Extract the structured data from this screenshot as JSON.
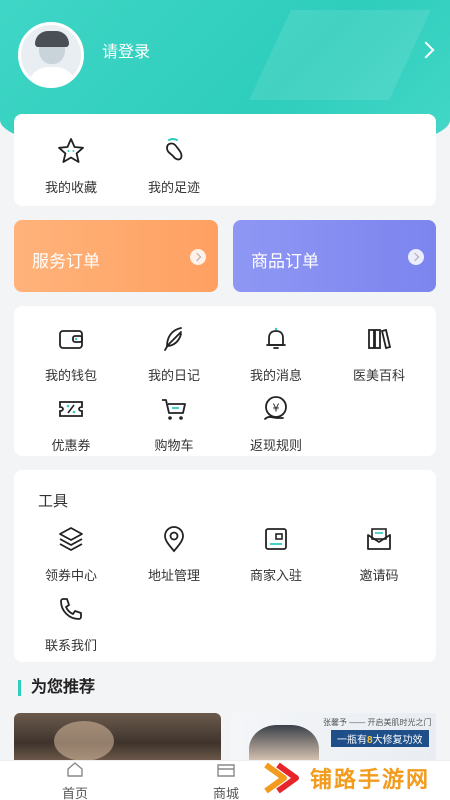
{
  "header": {
    "login_text": "请登录"
  },
  "quick": [
    {
      "label": "我的收藏",
      "icon": "star-icon"
    },
    {
      "label": "我的足迹",
      "icon": "footprint-icon"
    }
  ],
  "orders": {
    "service": "服务订单",
    "product": "商品订单"
  },
  "functions": [
    {
      "label": "我的钱包",
      "icon": "wallet-icon"
    },
    {
      "label": "我的日记",
      "icon": "feather-icon"
    },
    {
      "label": "我的消息",
      "icon": "bell-icon"
    },
    {
      "label": "医美百科",
      "icon": "books-icon"
    },
    {
      "label": "优惠券",
      "icon": "coupon-icon"
    },
    {
      "label": "购物车",
      "icon": "cart-icon"
    },
    {
      "label": "返现规则",
      "icon": "cashback-icon"
    }
  ],
  "tools": {
    "title": "工具",
    "items": [
      {
        "label": "领券中心",
        "icon": "layers-icon"
      },
      {
        "label": "地址管理",
        "icon": "location-pin-icon"
      },
      {
        "label": "商家入驻",
        "icon": "merchant-card-icon"
      },
      {
        "label": "邀请码",
        "icon": "envelope-icon"
      },
      {
        "label": "联系我们",
        "icon": "phone-icon"
      }
    ]
  },
  "recommend": {
    "title": "为您推荐",
    "banner2_line1": "张馨予 —— 开启美肌时光之门",
    "banner2_line2_pre": "一瓶有",
    "banner2_line2_num": "8",
    "banner2_line2_post": "大修复功效"
  },
  "tabbar": [
    {
      "label": "首页",
      "icon": "home-icon"
    },
    {
      "label": "商城",
      "icon": "store-icon"
    }
  ],
  "watermark": {
    "text": "铺路手游网"
  },
  "colors": {
    "accent": "#2ecdbc",
    "service_order": "#ffa062",
    "product_order": "#7c84ef",
    "watermark": "#f29b1d"
  }
}
